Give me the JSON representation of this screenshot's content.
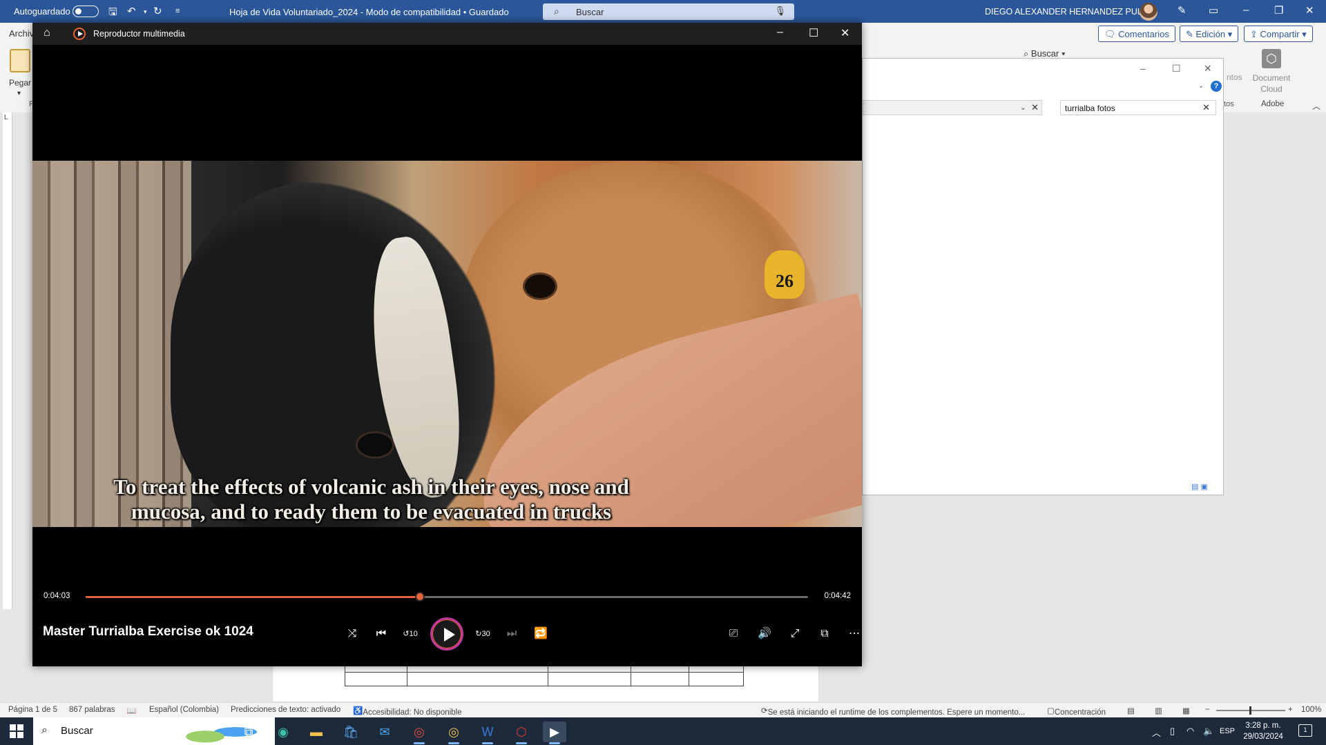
{
  "word": {
    "autosave_label": "Autoguardado",
    "doc_title": "Hoja de Vida Voluntariado_2024  -  Modo de compatibilidad  •  Guardado",
    "search_placeholder": "Buscar",
    "user_name": "DIEGO ALEXANDER HERNANDEZ PULIDO",
    "ribbon": {
      "tab_partial": "Archiv",
      "paste_label": "Pegar",
      "group_partial": "P",
      "comments_label": "Comentarios",
      "editing_label": "Edición",
      "share_label": "Compartir",
      "find_label": "Buscar",
      "document_cloud_label": "Document Cloud",
      "adobe_group_label": "Adobe",
      "partial_group_label": "atos",
      "partial_btn_label": "ntos"
    }
  },
  "search_pane": {
    "query": "turrialba fotos",
    "help_glyph": "?"
  },
  "player": {
    "app_title": "Reproductor multimedia",
    "subtitle_line1": "To treat the effects of volcanic ash in their eyes, nose and",
    "subtitle_line2": "mucosa, and to ready them to be evacuated in trucks",
    "ear_tag_number": "26",
    "current_time": "0:04:03",
    "total_time": "0:04:42",
    "progress_fraction": 0.463,
    "media_title": "Master Turrialba Exercise ok 1024",
    "skip_back_label": "10",
    "skip_forward_label": "30",
    "accent_color": "#e8643a"
  },
  "statusbar": {
    "page": "Página 1 de 5",
    "words": "867 palabras",
    "language": "Español (Colombia)",
    "predictions": "Predicciones de texto: activado",
    "accessibility": "Accesibilidad: No disponible",
    "addins_message": "Se está iniciando el runtime de los complementos. Espere un momento...",
    "focus": "Concentración",
    "zoom": "100%"
  },
  "taskbar": {
    "search_label": "Buscar",
    "language": "ESP",
    "time": "3:28 p. m.",
    "date": "29/03/2024",
    "notification_count": "1"
  }
}
